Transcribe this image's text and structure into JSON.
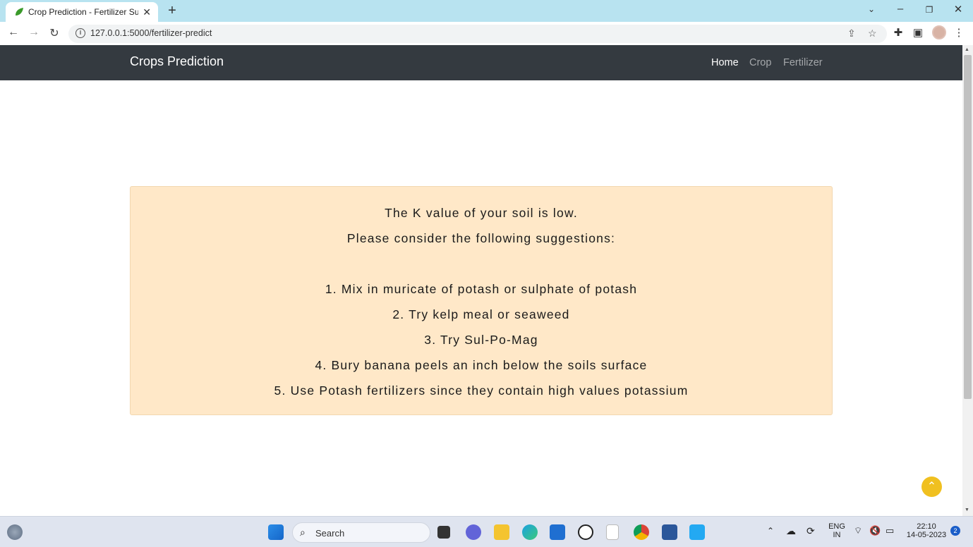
{
  "browser": {
    "tab_title": "Crop Prediction - Fertilizer Sugge",
    "url": "127.0.0.1:5000/fertilizer-predict"
  },
  "navbar": {
    "brand": "Crops Prediction",
    "links": [
      "Home",
      "Crop",
      "Fertilizer"
    ]
  },
  "card": {
    "lines": [
      "The K value of your soil is low.",
      "Please consider the following suggestions:",
      "1. Mix in muricate of potash or sulphate of potash",
      "2. Try kelp meal or seaweed",
      "3. Try Sul-Po-Mag",
      "4. Bury banana peels an inch below the soils surface",
      "5. Use Potash fertilizers since they contain high values potassium"
    ],
    "background_color": "#ffe8c8"
  },
  "taskbar": {
    "search_placeholder": "Search",
    "lang_top": "ENG",
    "lang_bottom": "IN",
    "time": "22:10",
    "date": "14-05-2023",
    "notifications": "2"
  },
  "colors": {
    "navbar": "#343a40",
    "back_to_top": "#f0c020"
  }
}
